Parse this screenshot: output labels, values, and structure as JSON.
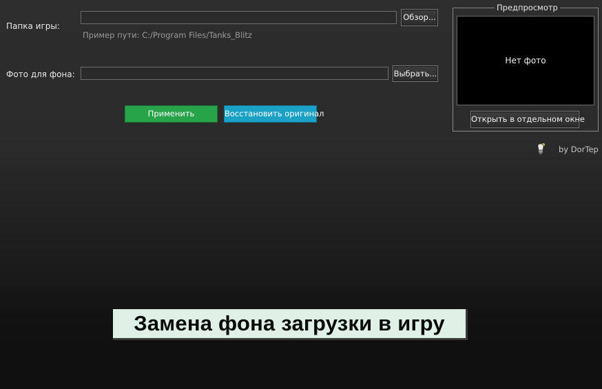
{
  "form": {
    "game_folder_label": "Папка игры:",
    "game_folder_value": "",
    "browse_button": "Обзор...",
    "path_hint": "Пример пути: C:/Program Files/Tanks_Blitz",
    "bg_photo_label": "Фото для фона:",
    "bg_photo_value": "",
    "choose_button": "Выбрать..."
  },
  "actions": {
    "apply_button": "Применить",
    "restore_button": "Восстановить оригинал"
  },
  "preview": {
    "title": "Предпросмотр",
    "placeholder": "Нет фото",
    "open_window_button": "Открыть в отдельном окне"
  },
  "footer": {
    "author": "by DorTep",
    "author_icon": "lightbulb-icon"
  },
  "overlay": {
    "caption": "Замена фона загрузки в игру"
  },
  "colors": {
    "apply": "#27a349",
    "restore": "#1ba1c6",
    "background": "#2d2d2d",
    "preview_bg": "#000000",
    "caption_bg": "#dff0e6"
  }
}
